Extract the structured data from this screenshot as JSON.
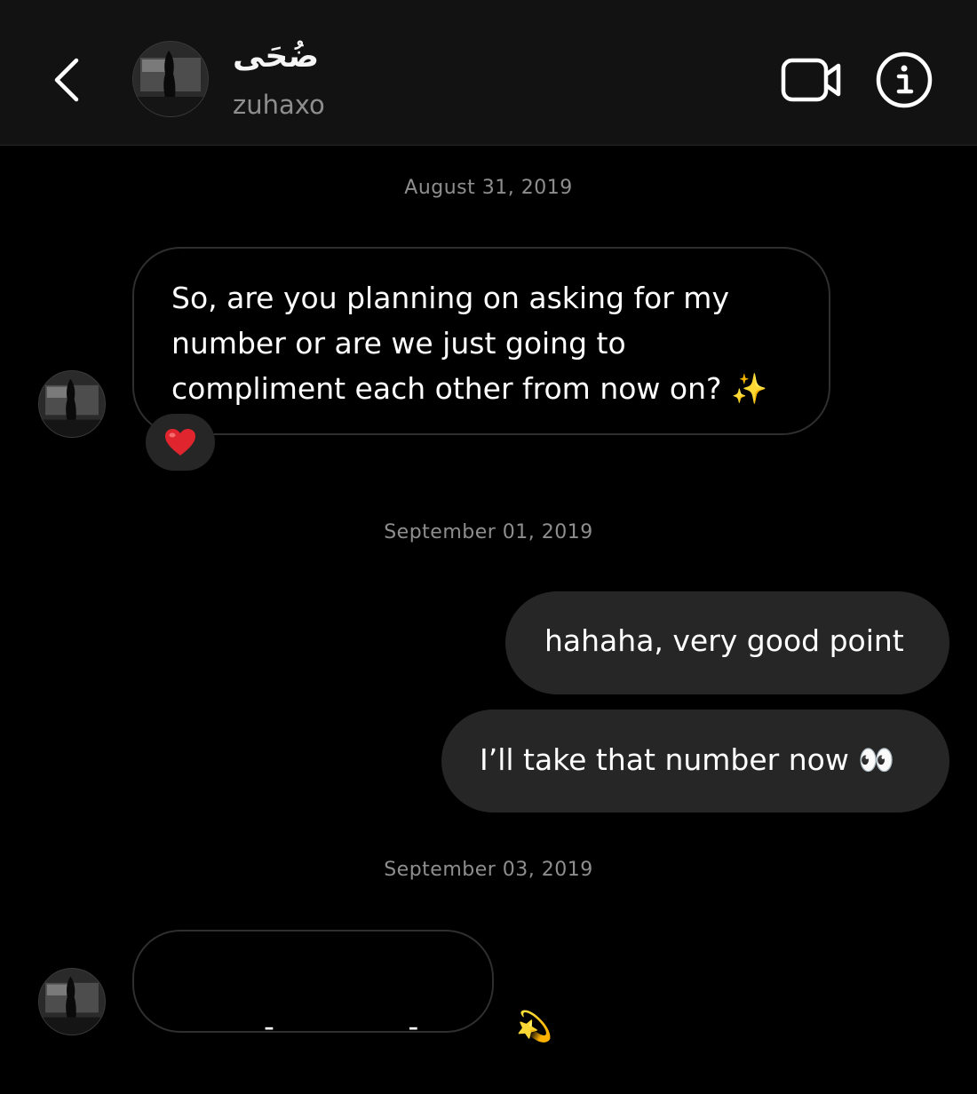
{
  "header": {
    "contact_name": "ضُحَى",
    "username": "zuhaxo",
    "icons": {
      "back": "chevron-left-icon",
      "video": "video-camera-icon",
      "info": "info-icon"
    }
  },
  "thread": {
    "dates": [
      "August 31, 2019",
      "September 01, 2019",
      "September 03, 2019"
    ],
    "messages": [
      {
        "direction": "incoming",
        "lines": [
          "So, are you planning on asking for my",
          "number or are we just going to",
          "compliment each other from now on? ✨"
        ],
        "reaction": "heart-emoji"
      },
      {
        "direction": "outgoing",
        "text": "hahaha, very good point"
      },
      {
        "direction": "outgoing",
        "text": "I’ll take that number now 👀"
      },
      {
        "direction": "incoming",
        "text": "- -",
        "emoji": "💫",
        "redacted": true
      }
    ]
  },
  "colors": {
    "background": "#000000",
    "header_background": "#121212",
    "outgoing_bubble": "#262626",
    "incoming_border": "#2f2f2f",
    "secondary_text": "#8e8e8e",
    "reaction_heart": "#e0252e"
  }
}
